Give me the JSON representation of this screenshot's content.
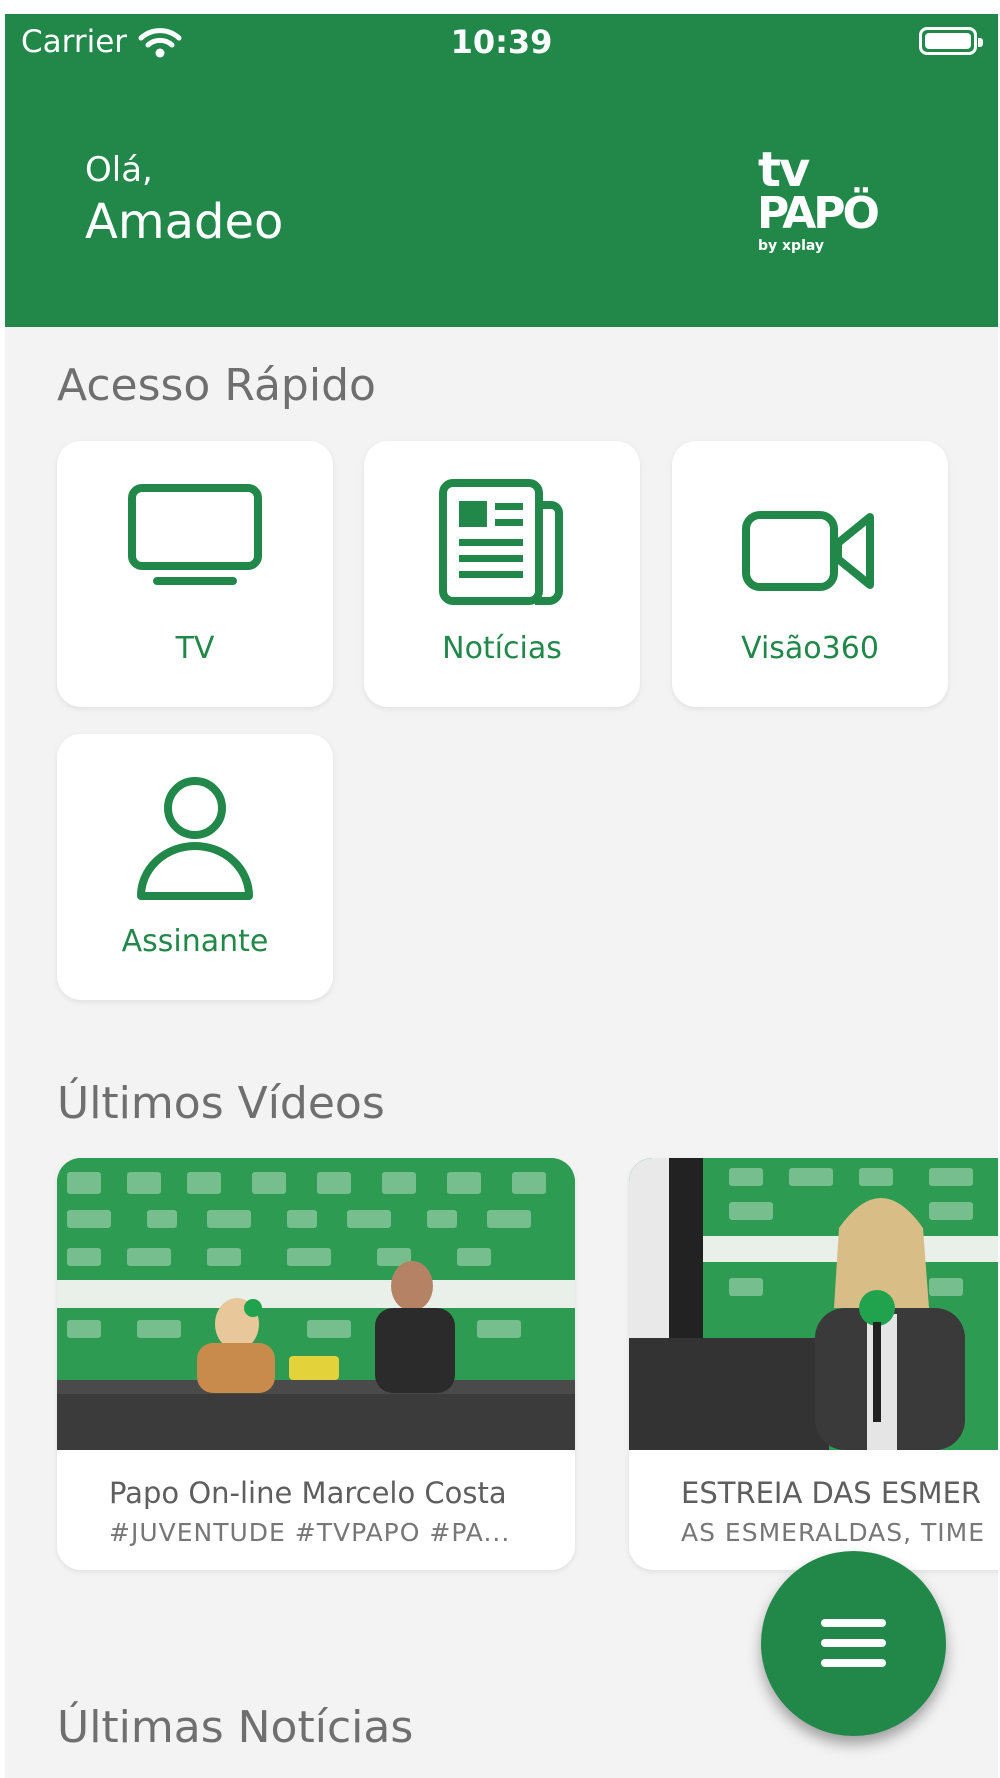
{
  "status_bar": {
    "carrier": "Carrier",
    "time": "10:39"
  },
  "header": {
    "greeting": "Olá,",
    "user_name": "Amadeo",
    "logo": {
      "line1": "tv",
      "line2": "PAPÖ",
      "byline": "by xplay"
    }
  },
  "quick_access": {
    "title": "Acesso Rápido",
    "items": [
      {
        "label": "TV",
        "icon": "tv-icon"
      },
      {
        "label": "Notícias",
        "icon": "newspaper-icon"
      },
      {
        "label": "Visão360",
        "icon": "video-camera-icon"
      },
      {
        "label": "Assinante",
        "icon": "user-icon"
      }
    ]
  },
  "latest_videos": {
    "title": "Últimos Vídeos",
    "items": [
      {
        "title": "Papo On-line Marcelo Costa",
        "subtitle": "#JUVENTUDE #TVPAPO #PA..."
      },
      {
        "title": "ESTREIA DAS ESMER",
        "subtitle": "AS ESMERALDAS, TIME"
      }
    ]
  },
  "latest_news": {
    "title": "Últimas Notícias"
  },
  "fab": {
    "icon": "menu-icon"
  },
  "colors": {
    "brand": "#21884a",
    "background": "#f3f3f3",
    "card": "#ffffff"
  }
}
